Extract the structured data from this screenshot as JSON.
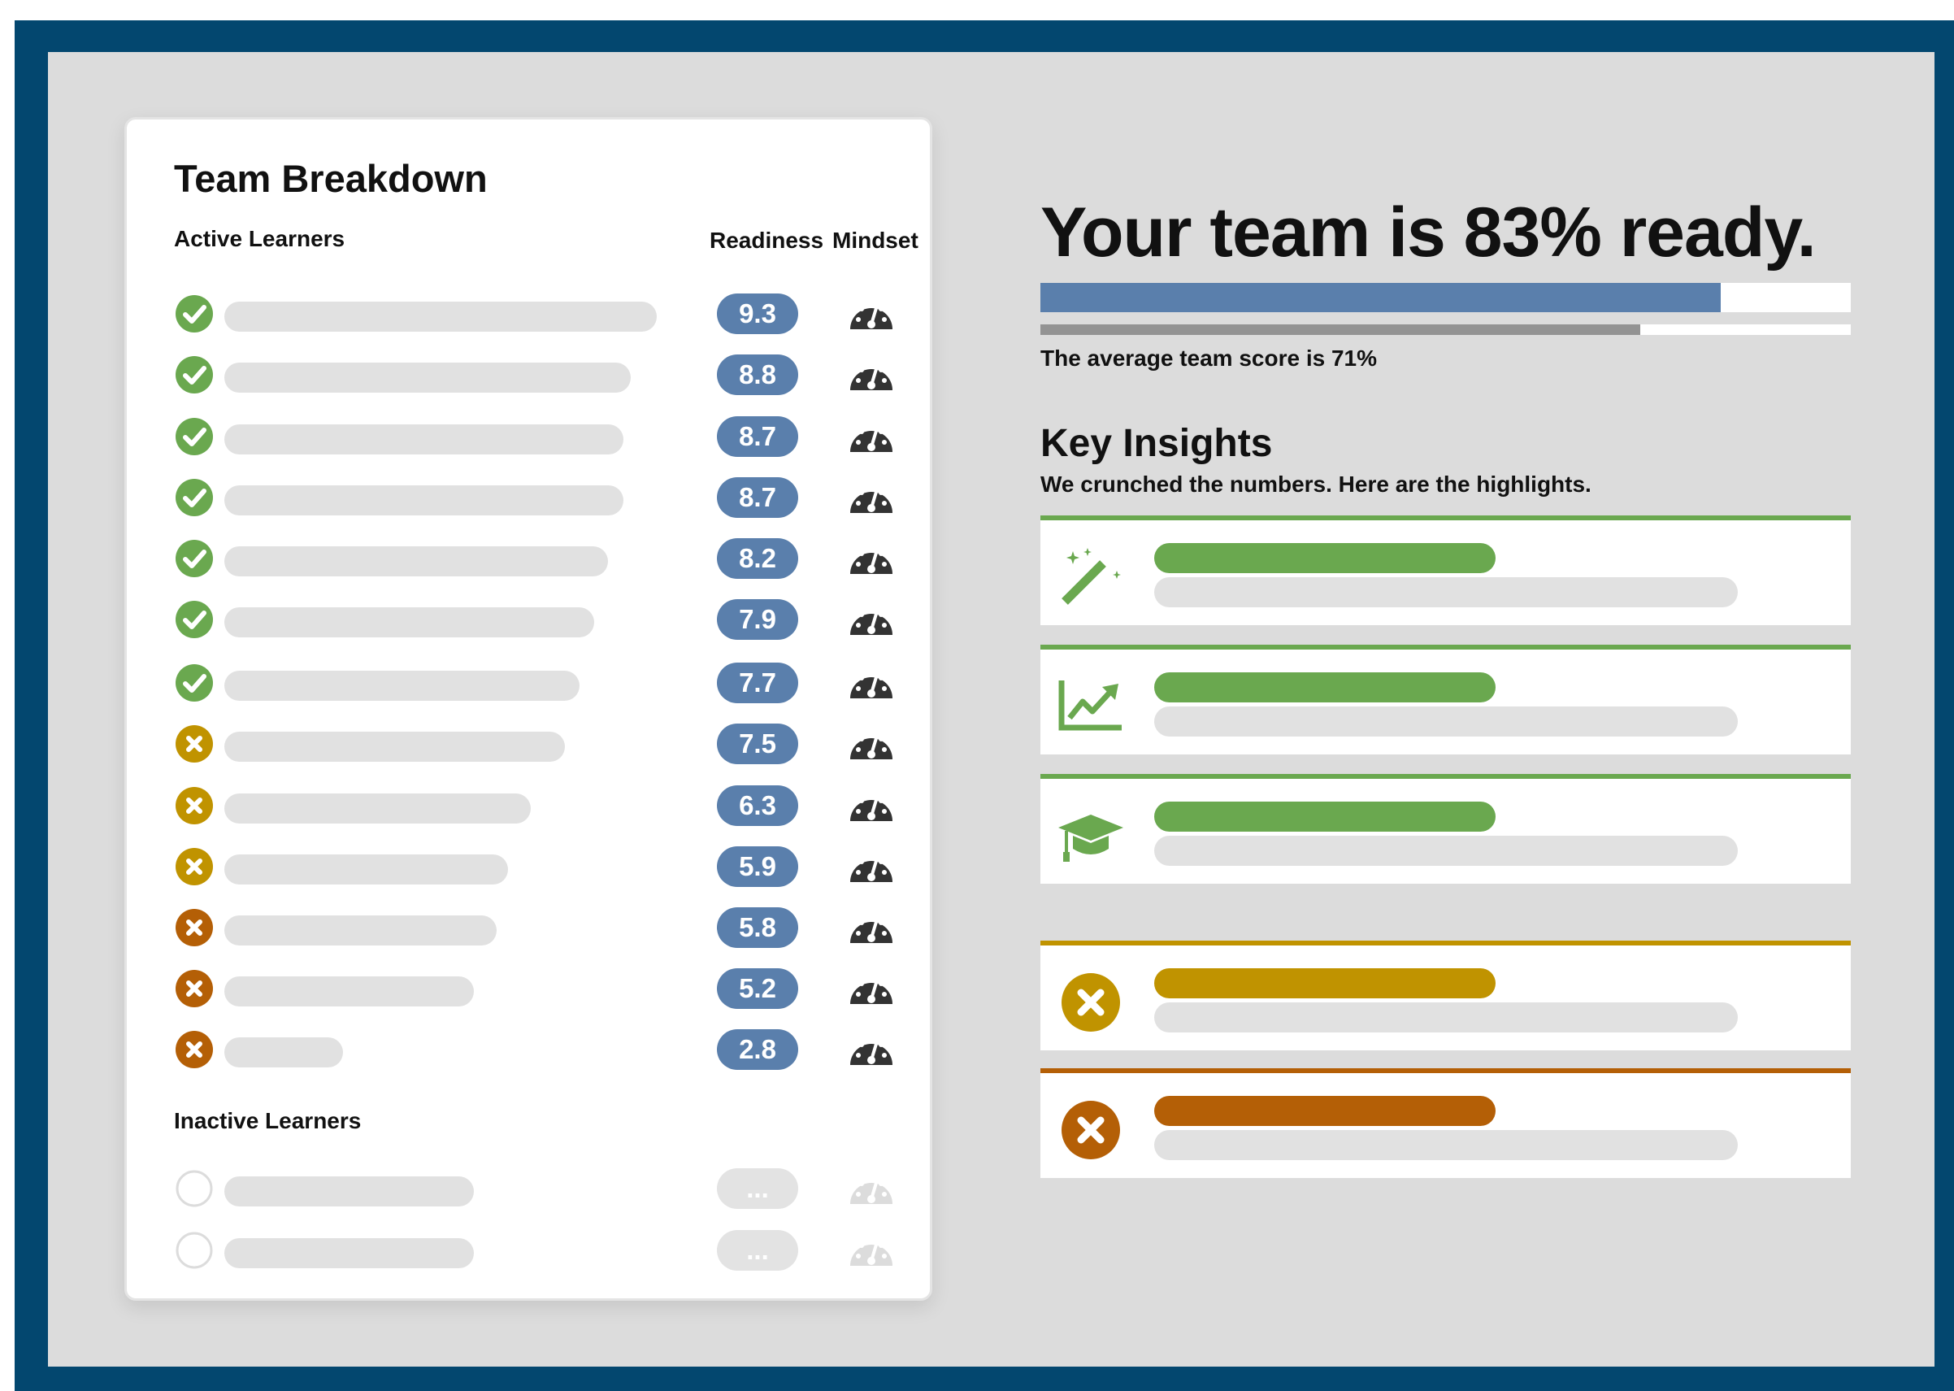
{
  "colors": {
    "frame": "#03476f",
    "background": "#dcdcdc",
    "accent_blue": "#5a7fac",
    "green": "#6aa84f",
    "yellow": "#c09300",
    "orange": "#b45f06",
    "gauge": "#333333",
    "placeholder": "#e1e1e1"
  },
  "breakdown": {
    "title": "Team Breakdown",
    "active_label": "Active Learners",
    "readiness_header": "Readiness",
    "mindset_header": "Mindset",
    "active": [
      {
        "status": "check",
        "score": "9.3"
      },
      {
        "status": "check",
        "score": "8.8"
      },
      {
        "status": "check",
        "score": "8.7"
      },
      {
        "status": "check",
        "score": "8.7"
      },
      {
        "status": "check",
        "score": "8.2"
      },
      {
        "status": "check",
        "score": "7.9"
      },
      {
        "status": "check",
        "score": "7.7"
      },
      {
        "status": "x-yellow",
        "score": "7.5"
      },
      {
        "status": "x-yellow",
        "score": "6.3"
      },
      {
        "status": "x-yellow",
        "score": "5.9"
      },
      {
        "status": "x-orange",
        "score": "5.8"
      },
      {
        "status": "x-orange",
        "score": "5.2"
      },
      {
        "status": "x-orange",
        "score": "2.8"
      }
    ],
    "inactive_label": "Inactive Learners",
    "inactive": [
      {
        "status": "empty",
        "score": "..."
      },
      {
        "status": "empty",
        "score": "..."
      }
    ]
  },
  "summary": {
    "headline": "Your team is 83% ready.",
    "team_readiness_fraction": 0.84,
    "average_fraction": 0.74,
    "average_text": "The average team score is 71%"
  },
  "insights": {
    "title": "Key Insights",
    "subtitle": "We crunched the numbers. Here are the highlights.",
    "cards": [
      {
        "tone": "good",
        "icon": "magic-wand-icon"
      },
      {
        "tone": "good",
        "icon": "trending-up-chart-icon"
      },
      {
        "tone": "good",
        "icon": "graduation-cap-icon"
      },
      {
        "tone": "warn",
        "icon": "x-circle-icon"
      },
      {
        "tone": "bad",
        "icon": "x-circle-icon"
      }
    ]
  }
}
